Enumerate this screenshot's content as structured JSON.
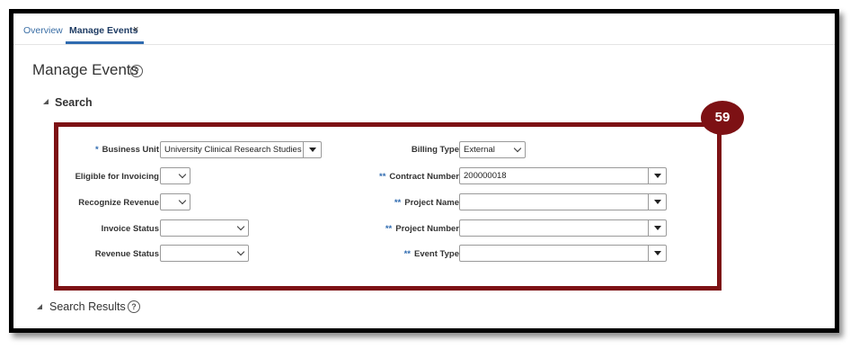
{
  "tabs": {
    "overview": "Overview",
    "manage_events": "Manage Events",
    "close": "×"
  },
  "page": {
    "title": "Manage Events",
    "help": "?"
  },
  "search": {
    "title": "Search",
    "badge": "59",
    "required_star": "*",
    "one_required": "**",
    "left_fields": {
      "business_unit": {
        "label": "Business Unit",
        "value": "University Clinical Research Studies"
      },
      "eligible_for_invoicing": {
        "label": "Eligible for Invoicing",
        "value": ""
      },
      "recognize_revenue": {
        "label": "Recognize Revenue",
        "value": ""
      },
      "invoice_status": {
        "label": "Invoice Status",
        "value": ""
      },
      "revenue_status": {
        "label": "Revenue Status",
        "value": ""
      }
    },
    "right_fields": {
      "billing_type": {
        "label": "Billing Type",
        "value": "External"
      },
      "contract_number": {
        "label": "Contract Number",
        "value": "200000018"
      },
      "project_name": {
        "label": "Project Name",
        "value": ""
      },
      "project_number": {
        "label": "Project Number",
        "value": ""
      },
      "event_type": {
        "label": "Event Type",
        "value": ""
      }
    }
  },
  "results": {
    "title": "Search Results",
    "help": "?"
  }
}
